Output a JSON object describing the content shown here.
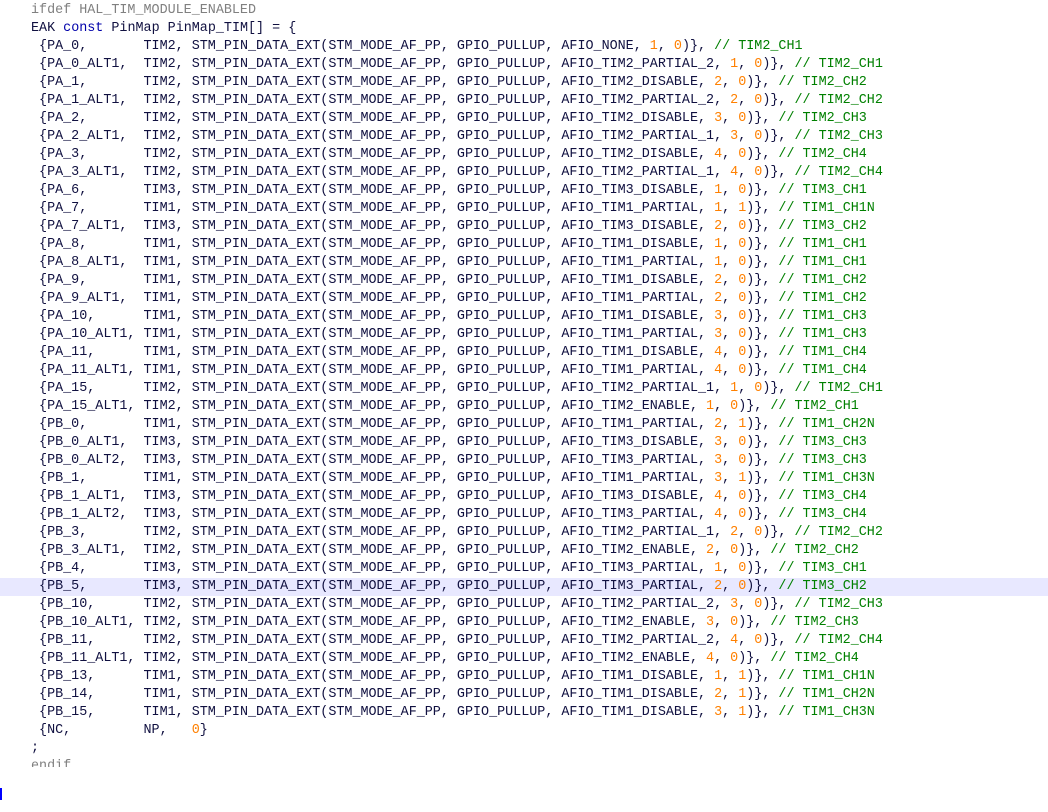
{
  "preprocessor": {
    "ifdef": "ifdef HAL_TIM_MODULE_ENABLED",
    "endif": "endif"
  },
  "declaration": {
    "prefix": "EAK",
    "keyword": "const",
    "type": "PinMap",
    "name": "PinMap_TIM[]",
    "op": " = {"
  },
  "rows": [
    {
      "pin": "PA_0",
      "tim": "TIM2",
      "mode": "STM_MODE_AF_PP",
      "pull": "GPIO_PULLUP",
      "afio": "AFIO_NONE",
      "ch": "1",
      "inv": "0",
      "comment": "// TIM2_CH1"
    },
    {
      "pin": "PA_0_ALT1",
      "tim": "TIM2",
      "mode": "STM_MODE_AF_PP",
      "pull": "GPIO_PULLUP",
      "afio": "AFIO_TIM2_PARTIAL_2",
      "ch": "1",
      "inv": "0",
      "comment": "// TIM2_CH1"
    },
    {
      "pin": "PA_1",
      "tim": "TIM2",
      "mode": "STM_MODE_AF_PP",
      "pull": "GPIO_PULLUP",
      "afio": "AFIO_TIM2_DISABLE",
      "ch": "2",
      "inv": "0",
      "comment": "// TIM2_CH2"
    },
    {
      "pin": "PA_1_ALT1",
      "tim": "TIM2",
      "mode": "STM_MODE_AF_PP",
      "pull": "GPIO_PULLUP",
      "afio": "AFIO_TIM2_PARTIAL_2",
      "ch": "2",
      "inv": "0",
      "comment": "// TIM2_CH2"
    },
    {
      "pin": "PA_2",
      "tim": "TIM2",
      "mode": "STM_MODE_AF_PP",
      "pull": "GPIO_PULLUP",
      "afio": "AFIO_TIM2_DISABLE",
      "ch": "3",
      "inv": "0",
      "comment": "// TIM2_CH3"
    },
    {
      "pin": "PA_2_ALT1",
      "tim": "TIM2",
      "mode": "STM_MODE_AF_PP",
      "pull": "GPIO_PULLUP",
      "afio": "AFIO_TIM2_PARTIAL_1",
      "ch": "3",
      "inv": "0",
      "comment": "// TIM2_CH3"
    },
    {
      "pin": "PA_3",
      "tim": "TIM2",
      "mode": "STM_MODE_AF_PP",
      "pull": "GPIO_PULLUP",
      "afio": "AFIO_TIM2_DISABLE",
      "ch": "4",
      "inv": "0",
      "comment": "// TIM2_CH4"
    },
    {
      "pin": "PA_3_ALT1",
      "tim": "TIM2",
      "mode": "STM_MODE_AF_PP",
      "pull": "GPIO_PULLUP",
      "afio": "AFIO_TIM2_PARTIAL_1",
      "ch": "4",
      "inv": "0",
      "comment": "// TIM2_CH4"
    },
    {
      "pin": "PA_6",
      "tim": "TIM3",
      "mode": "STM_MODE_AF_PP",
      "pull": "GPIO_PULLUP",
      "afio": "AFIO_TIM3_DISABLE",
      "ch": "1",
      "inv": "0",
      "comment": "// TIM3_CH1"
    },
    {
      "pin": "PA_7",
      "tim": "TIM1",
      "mode": "STM_MODE_AF_PP",
      "pull": "GPIO_PULLUP",
      "afio": "AFIO_TIM1_PARTIAL",
      "ch": "1",
      "inv": "1",
      "comment": "// TIM1_CH1N"
    },
    {
      "pin": "PA_7_ALT1",
      "tim": "TIM3",
      "mode": "STM_MODE_AF_PP",
      "pull": "GPIO_PULLUP",
      "afio": "AFIO_TIM3_DISABLE",
      "ch": "2",
      "inv": "0",
      "comment": "// TIM3_CH2"
    },
    {
      "pin": "PA_8",
      "tim": "TIM1",
      "mode": "STM_MODE_AF_PP",
      "pull": "GPIO_PULLUP",
      "afio": "AFIO_TIM1_DISABLE",
      "ch": "1",
      "inv": "0",
      "comment": "// TIM1_CH1"
    },
    {
      "pin": "PA_8_ALT1",
      "tim": "TIM1",
      "mode": "STM_MODE_AF_PP",
      "pull": "GPIO_PULLUP",
      "afio": "AFIO_TIM1_PARTIAL",
      "ch": "1",
      "inv": "0",
      "comment": "// TIM1_CH1"
    },
    {
      "pin": "PA_9",
      "tim": "TIM1",
      "mode": "STM_MODE_AF_PP",
      "pull": "GPIO_PULLUP",
      "afio": "AFIO_TIM1_DISABLE",
      "ch": "2",
      "inv": "0",
      "comment": "// TIM1_CH2"
    },
    {
      "pin": "PA_9_ALT1",
      "tim": "TIM1",
      "mode": "STM_MODE_AF_PP",
      "pull": "GPIO_PULLUP",
      "afio": "AFIO_TIM1_PARTIAL",
      "ch": "2",
      "inv": "0",
      "comment": "// TIM1_CH2"
    },
    {
      "pin": "PA_10",
      "tim": "TIM1",
      "mode": "STM_MODE_AF_PP",
      "pull": "GPIO_PULLUP",
      "afio": "AFIO_TIM1_DISABLE",
      "ch": "3",
      "inv": "0",
      "comment": "// TIM1_CH3"
    },
    {
      "pin": "PA_10_ALT1",
      "tim": "TIM1",
      "mode": "STM_MODE_AF_PP",
      "pull": "GPIO_PULLUP",
      "afio": "AFIO_TIM1_PARTIAL",
      "ch": "3",
      "inv": "0",
      "comment": "// TIM1_CH3"
    },
    {
      "pin": "PA_11",
      "tim": "TIM1",
      "mode": "STM_MODE_AF_PP",
      "pull": "GPIO_PULLUP",
      "afio": "AFIO_TIM1_DISABLE",
      "ch": "4",
      "inv": "0",
      "comment": "// TIM1_CH4"
    },
    {
      "pin": "PA_11_ALT1",
      "tim": "TIM1",
      "mode": "STM_MODE_AF_PP",
      "pull": "GPIO_PULLUP",
      "afio": "AFIO_TIM1_PARTIAL",
      "ch": "4",
      "inv": "0",
      "comment": "// TIM1_CH4"
    },
    {
      "pin": "PA_15",
      "tim": "TIM2",
      "mode": "STM_MODE_AF_PP",
      "pull": "GPIO_PULLUP",
      "afio": "AFIO_TIM2_PARTIAL_1",
      "ch": "1",
      "inv": "0",
      "comment": "// TIM2_CH1"
    },
    {
      "pin": "PA_15_ALT1",
      "tim": "TIM2",
      "mode": "STM_MODE_AF_PP",
      "pull": "GPIO_PULLUP",
      "afio": "AFIO_TIM2_ENABLE",
      "ch": "1",
      "inv": "0",
      "comment": "// TIM2_CH1"
    },
    {
      "pin": "PB_0",
      "tim": "TIM1",
      "mode": "STM_MODE_AF_PP",
      "pull": "GPIO_PULLUP",
      "afio": "AFIO_TIM1_PARTIAL",
      "ch": "2",
      "inv": "1",
      "comment": "// TIM1_CH2N"
    },
    {
      "pin": "PB_0_ALT1",
      "tim": "TIM3",
      "mode": "STM_MODE_AF_PP",
      "pull": "GPIO_PULLUP",
      "afio": "AFIO_TIM3_DISABLE",
      "ch": "3",
      "inv": "0",
      "comment": "// TIM3_CH3"
    },
    {
      "pin": "PB_0_ALT2",
      "tim": "TIM3",
      "mode": "STM_MODE_AF_PP",
      "pull": "GPIO_PULLUP",
      "afio": "AFIO_TIM3_PARTIAL",
      "ch": "3",
      "inv": "0",
      "comment": "// TIM3_CH3"
    },
    {
      "pin": "PB_1",
      "tim": "TIM1",
      "mode": "STM_MODE_AF_PP",
      "pull": "GPIO_PULLUP",
      "afio": "AFIO_TIM1_PARTIAL",
      "ch": "3",
      "inv": "1",
      "comment": "// TIM1_CH3N"
    },
    {
      "pin": "PB_1_ALT1",
      "tim": "TIM3",
      "mode": "STM_MODE_AF_PP",
      "pull": "GPIO_PULLUP",
      "afio": "AFIO_TIM3_DISABLE",
      "ch": "4",
      "inv": "0",
      "comment": "// TIM3_CH4"
    },
    {
      "pin": "PB_1_ALT2",
      "tim": "TIM3",
      "mode": "STM_MODE_AF_PP",
      "pull": "GPIO_PULLUP",
      "afio": "AFIO_TIM3_PARTIAL",
      "ch": "4",
      "inv": "0",
      "comment": "// TIM3_CH4"
    },
    {
      "pin": "PB_3",
      "tim": "TIM2",
      "mode": "STM_MODE_AF_PP",
      "pull": "GPIO_PULLUP",
      "afio": "AFIO_TIM2_PARTIAL_1",
      "ch": "2",
      "inv": "0",
      "comment": "// TIM2_CH2"
    },
    {
      "pin": "PB_3_ALT1",
      "tim": "TIM2",
      "mode": "STM_MODE_AF_PP",
      "pull": "GPIO_PULLUP",
      "afio": "AFIO_TIM2_ENABLE",
      "ch": "2",
      "inv": "0",
      "comment": "// TIM2_CH2"
    },
    {
      "pin": "PB_4",
      "tim": "TIM3",
      "mode": "STM_MODE_AF_PP",
      "pull": "GPIO_PULLUP",
      "afio": "AFIO_TIM3_PARTIAL",
      "ch": "1",
      "inv": "0",
      "comment": "// TIM3_CH1"
    },
    {
      "pin": "PB_5",
      "tim": "TIM3",
      "mode": "STM_MODE_AF_PP",
      "pull": "GPIO_PULLUP",
      "afio": "AFIO_TIM3_PARTIAL",
      "ch": "2",
      "inv": "0",
      "comment": "// TIM3_CH2",
      "highlighted": true
    },
    {
      "pin": "PB_10",
      "tim": "TIM2",
      "mode": "STM_MODE_AF_PP",
      "pull": "GPIO_PULLUP",
      "afio": "AFIO_TIM2_PARTIAL_2",
      "ch": "3",
      "inv": "0",
      "comment": "// TIM2_CH3"
    },
    {
      "pin": "PB_10_ALT1",
      "tim": "TIM2",
      "mode": "STM_MODE_AF_PP",
      "pull": "GPIO_PULLUP",
      "afio": "AFIO_TIM2_ENABLE",
      "ch": "3",
      "inv": "0",
      "comment": "// TIM2_CH3"
    },
    {
      "pin": "PB_11",
      "tim": "TIM2",
      "mode": "STM_MODE_AF_PP",
      "pull": "GPIO_PULLUP",
      "afio": "AFIO_TIM2_PARTIAL_2",
      "ch": "4",
      "inv": "0",
      "comment": "// TIM2_CH4"
    },
    {
      "pin": "PB_11_ALT1",
      "tim": "TIM2",
      "mode": "STM_MODE_AF_PP",
      "pull": "GPIO_PULLUP",
      "afio": "AFIO_TIM2_ENABLE",
      "ch": "4",
      "inv": "0",
      "comment": "// TIM2_CH4"
    },
    {
      "pin": "PB_13",
      "tim": "TIM1",
      "mode": "STM_MODE_AF_PP",
      "pull": "GPIO_PULLUP",
      "afio": "AFIO_TIM1_DISABLE",
      "ch": "1",
      "inv": "1",
      "comment": "// TIM1_CH1N"
    },
    {
      "pin": "PB_14",
      "tim": "TIM1",
      "mode": "STM_MODE_AF_PP",
      "pull": "GPIO_PULLUP",
      "afio": "AFIO_TIM1_DISABLE",
      "ch": "2",
      "inv": "1",
      "comment": "// TIM1_CH2N"
    },
    {
      "pin": "PB_15",
      "tim": "TIM1",
      "mode": "STM_MODE_AF_PP",
      "pull": "GPIO_PULLUP",
      "afio": "AFIO_TIM1_DISABLE",
      "ch": "3",
      "inv": "1",
      "comment": "// TIM1_CH3N"
    }
  ],
  "terminator": {
    "pin": "NC",
    "tim": "NP",
    "value": "0"
  },
  "close": ";",
  "syntax_colors": {
    "keyword": "#0000aa",
    "text": "#101040",
    "preprocessor": "#808080",
    "number": "#ff8000",
    "comment": "#008000",
    "current_line": "#e8e8ff",
    "caret": "#0000ff"
  }
}
